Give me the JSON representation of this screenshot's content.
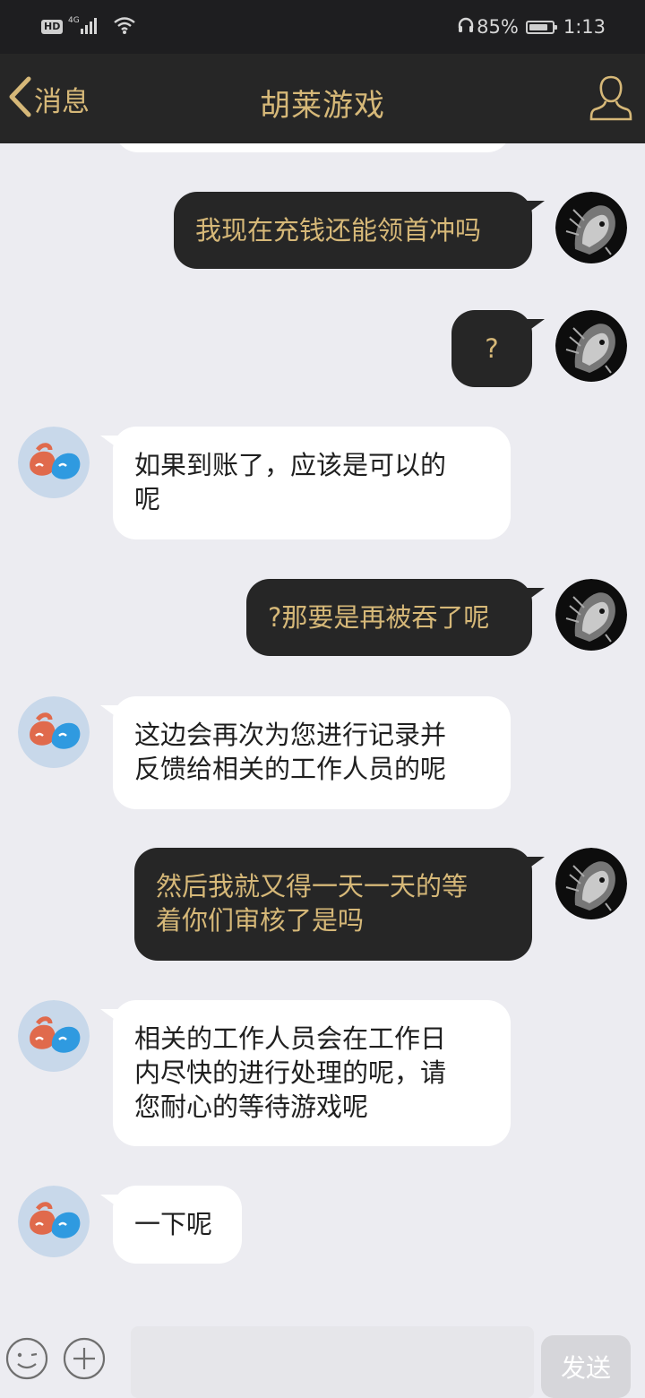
{
  "status_bar": {
    "network": "4G",
    "hd_label": "HD",
    "battery_percent": 85,
    "battery_label": "85%",
    "time": "1:13"
  },
  "nav": {
    "back_label": "消息",
    "title": "胡莱游戏"
  },
  "messages": [
    {
      "direction": "out",
      "lines": [
        "我现在充钱还能领首冲吗"
      ]
    },
    {
      "direction": "out",
      "lines": [
        "?"
      ]
    },
    {
      "direction": "in",
      "lines": [
        "如果到账了，应该是可以的",
        "呢"
      ]
    },
    {
      "direction": "out",
      "lines": [
        "?那要是再被吞了呢"
      ]
    },
    {
      "direction": "in",
      "lines": [
        "这边会再次为您进行记录并",
        "反馈给相关的工作人员的呢"
      ]
    },
    {
      "direction": "out",
      "lines": [
        "然后我就又得一天一天的等",
        "着你们审核了是吗"
      ]
    },
    {
      "direction": "in",
      "lines": [
        "相关的工作人员会在工作日",
        "内尽快的进行处理的呢，请",
        "您耐心的等待游戏呢"
      ]
    },
    {
      "direction": "in",
      "lines": [
        "一下呢"
      ]
    }
  ],
  "input": {
    "value": "",
    "send_label": "发送"
  },
  "colors": {
    "gold": "#d6b878",
    "dark": "#262626",
    "background": "#ececf1"
  },
  "icons": {
    "back": "chevron-left-icon",
    "profile": "person-outline-icon",
    "emoji": "emoji-icon",
    "plus": "plus-circle-icon"
  }
}
